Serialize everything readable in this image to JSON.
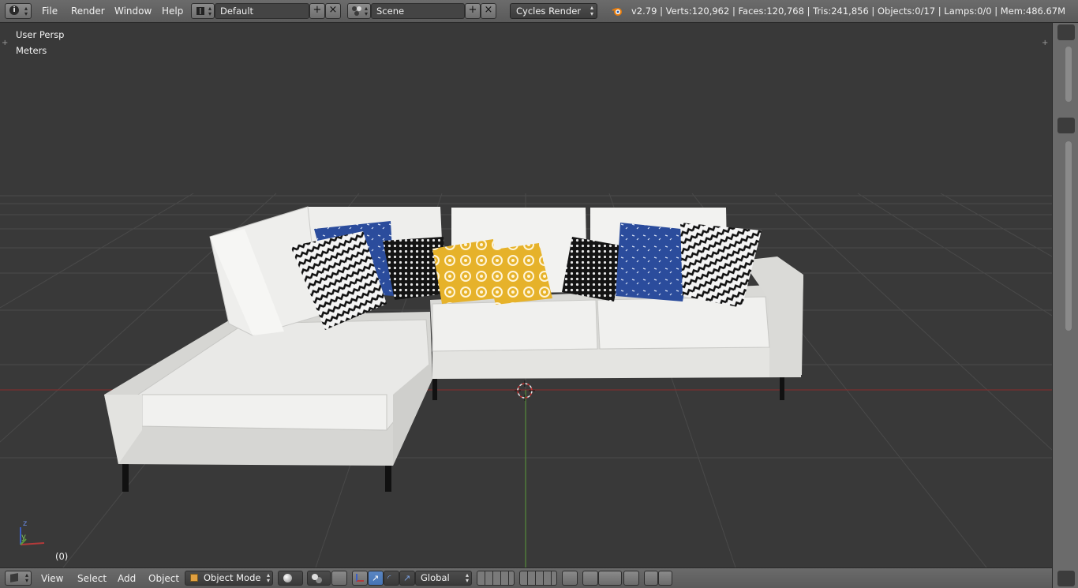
{
  "header": {
    "menus": [
      "File",
      "Render",
      "Window",
      "Help"
    ],
    "layout": {
      "name": "Default"
    },
    "scene": {
      "name": "Scene"
    },
    "render_engine": "Cycles Render",
    "stats": "v2.79 | Verts:120,962 | Faces:120,768 | Tris:241,856 | Objects:0/17 | Lamps:0/0 | Mem:486.67M"
  },
  "viewport": {
    "view_label": "User Persp",
    "units_label": "Meters",
    "frame_label": "(0)",
    "axis_labels": {
      "z": "z",
      "y": "y"
    }
  },
  "footer": {
    "menus": [
      "View",
      "Select",
      "Add",
      "Object"
    ],
    "mode": "Object Mode",
    "orientation": "Global"
  },
  "colors": {
    "viewport_bg": "#393939",
    "grid": "#4a4a4a",
    "x_axis": "#8a2a2a",
    "y_axis": "#5b9a3a",
    "sofa": "#e8e8e6",
    "pillow_blue": "#2b4c9c",
    "pillow_yellow": "#e6b22a",
    "accent_blue": "#5a86c2"
  },
  "icons": {
    "info": "info-icon",
    "screen": "screen-layout-icon",
    "scene": "scene-icon",
    "blender": "blender-logo-icon",
    "cursor": "3d-cursor-icon"
  }
}
